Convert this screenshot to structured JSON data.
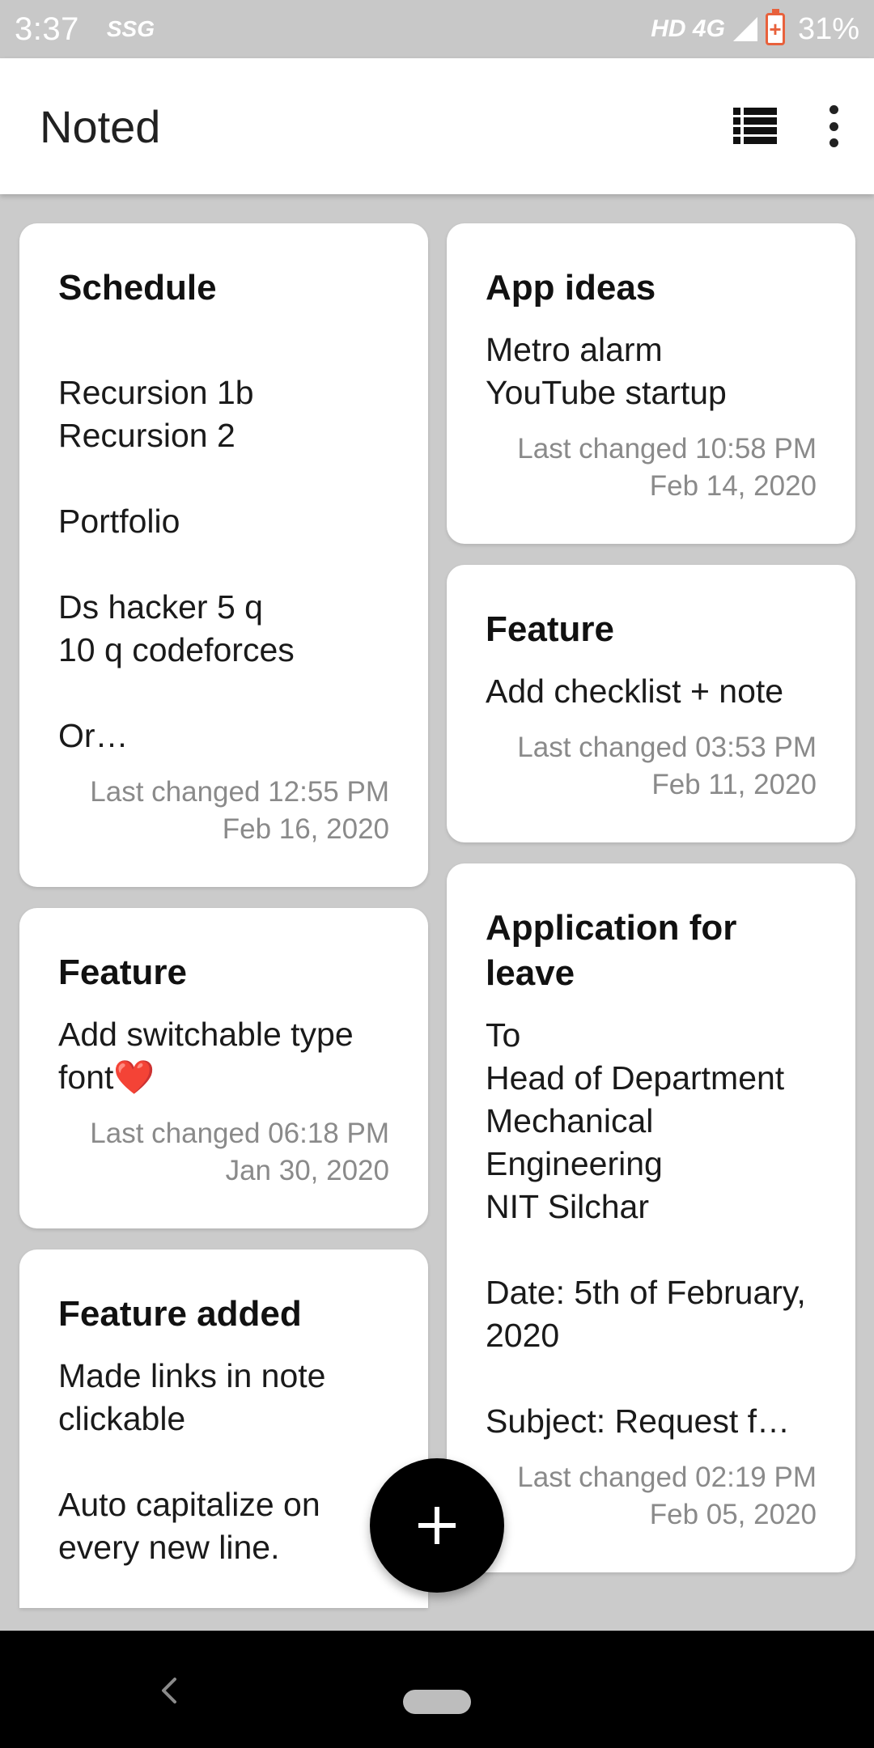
{
  "status_bar": {
    "time": "3:37",
    "carrier": "SSG",
    "network": "HD 4G",
    "battery": "31%"
  },
  "app_bar": {
    "title": "Noted",
    "icons": [
      "list-view-icon",
      "more-vert-icon"
    ]
  },
  "notes": {
    "left": [
      {
        "title": "Schedule",
        "body": "\nRecursion 1b\nRecursion 2\n\nPortfolio\n\nDs hacker 5 q\n10 q codeforces\n\nOr…",
        "date": "Last changed 12:55 PM Feb 16, 2020"
      },
      {
        "title": "Feature",
        "body": "Add switchable type font❤️",
        "date": "Last changed 06:18 PM Jan 30, 2020"
      },
      {
        "title": "Feature added",
        "body": "Made links in note clickable\n\nAuto capitalize on every new line.",
        "date": ""
      }
    ],
    "right": [
      {
        "title": "App ideas",
        "body": "Metro alarm\nYouTube startup",
        "date": "Last changed 10:58 PM Feb 14, 2020"
      },
      {
        "title": "Feature",
        "body": "Add checklist + note",
        "date": "Last changed 03:53 PM Feb 11, 2020"
      },
      {
        "title": "Application for leave",
        "body": "To\nHead of Department\nMechanical Engineering\nNIT Silchar\n\nDate: 5th of February, 2020\n\nSubject: Request f…",
        "date": "Last changed 02:19 PM Feb 05, 2020"
      }
    ]
  },
  "fab": {
    "icon": "add-icon"
  },
  "colors": {
    "background": "#cbcbcb",
    "card": "#ffffff",
    "fab": "#000000",
    "date_text": "#8a8a8a",
    "battery": "#e8613c"
  }
}
